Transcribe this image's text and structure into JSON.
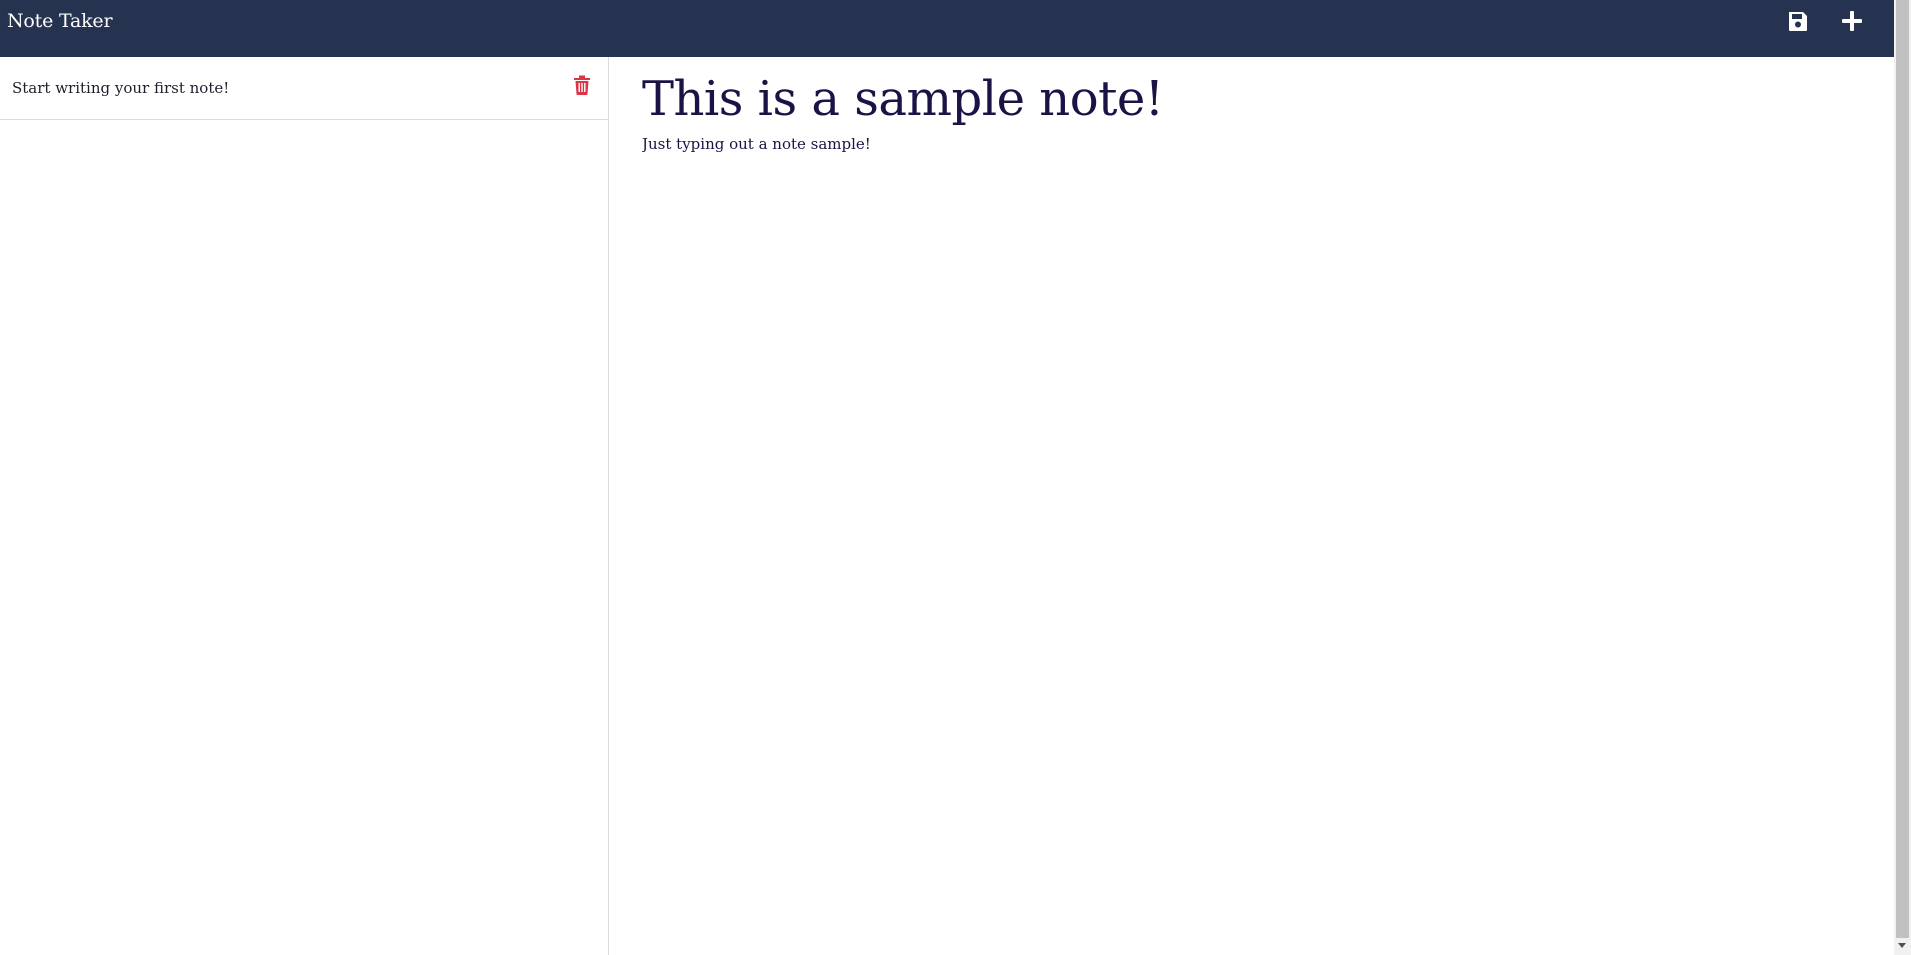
{
  "app": {
    "title": "Note Taker"
  },
  "toolbar": {
    "save_icon": "floppy-disk-icon",
    "new_icon": "plus-icon"
  },
  "notes": [
    {
      "title": "Start writing your first note!",
      "delete_icon": "trash-icon"
    }
  ],
  "editor": {
    "title": "This is a sample note!",
    "text": "Just typing out a note sample!"
  },
  "colors": {
    "navbar": "#253350",
    "delete": "#dc3545",
    "text": "#1a1446"
  }
}
